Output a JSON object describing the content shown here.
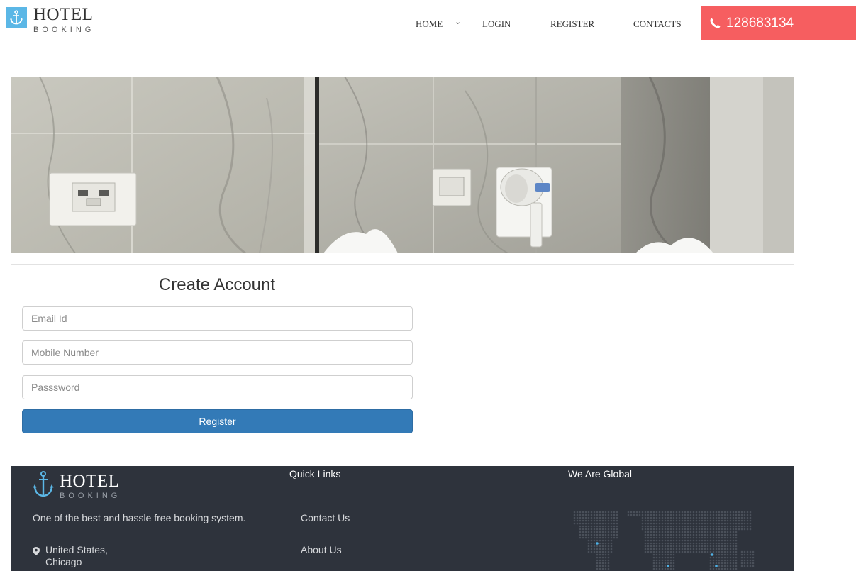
{
  "header": {
    "logo_title": "HOTEL",
    "logo_subtitle": "BOOKING",
    "nav": {
      "home": "HOME",
      "login": "LOGIN",
      "register": "REGISTER",
      "contacts": "CONTACTS"
    },
    "phone": "128683134",
    "phone_bg": "#f65e60"
  },
  "banner": {
    "icon": "bathroom-photo"
  },
  "form": {
    "title": "Create Account",
    "email_placeholder": "Email Id",
    "mobile_placeholder": "Mobile Number",
    "password_placeholder": "Passsword",
    "register_label": "Register",
    "button_color": "#337ab7"
  },
  "footer": {
    "logo_title": "HOTEL",
    "logo_subtitle": "BOOKING",
    "tagline": "One of the best and hassle free booking system.",
    "address_line1": "United States,",
    "address_line2": "Chicago",
    "quick_links_heading": "Quick Links",
    "links": [
      "Contact Us",
      "About Us"
    ],
    "global_heading": "We Are Global",
    "background": "#2e333c"
  },
  "colors": {
    "logo_accent": "#5bb7e6"
  }
}
